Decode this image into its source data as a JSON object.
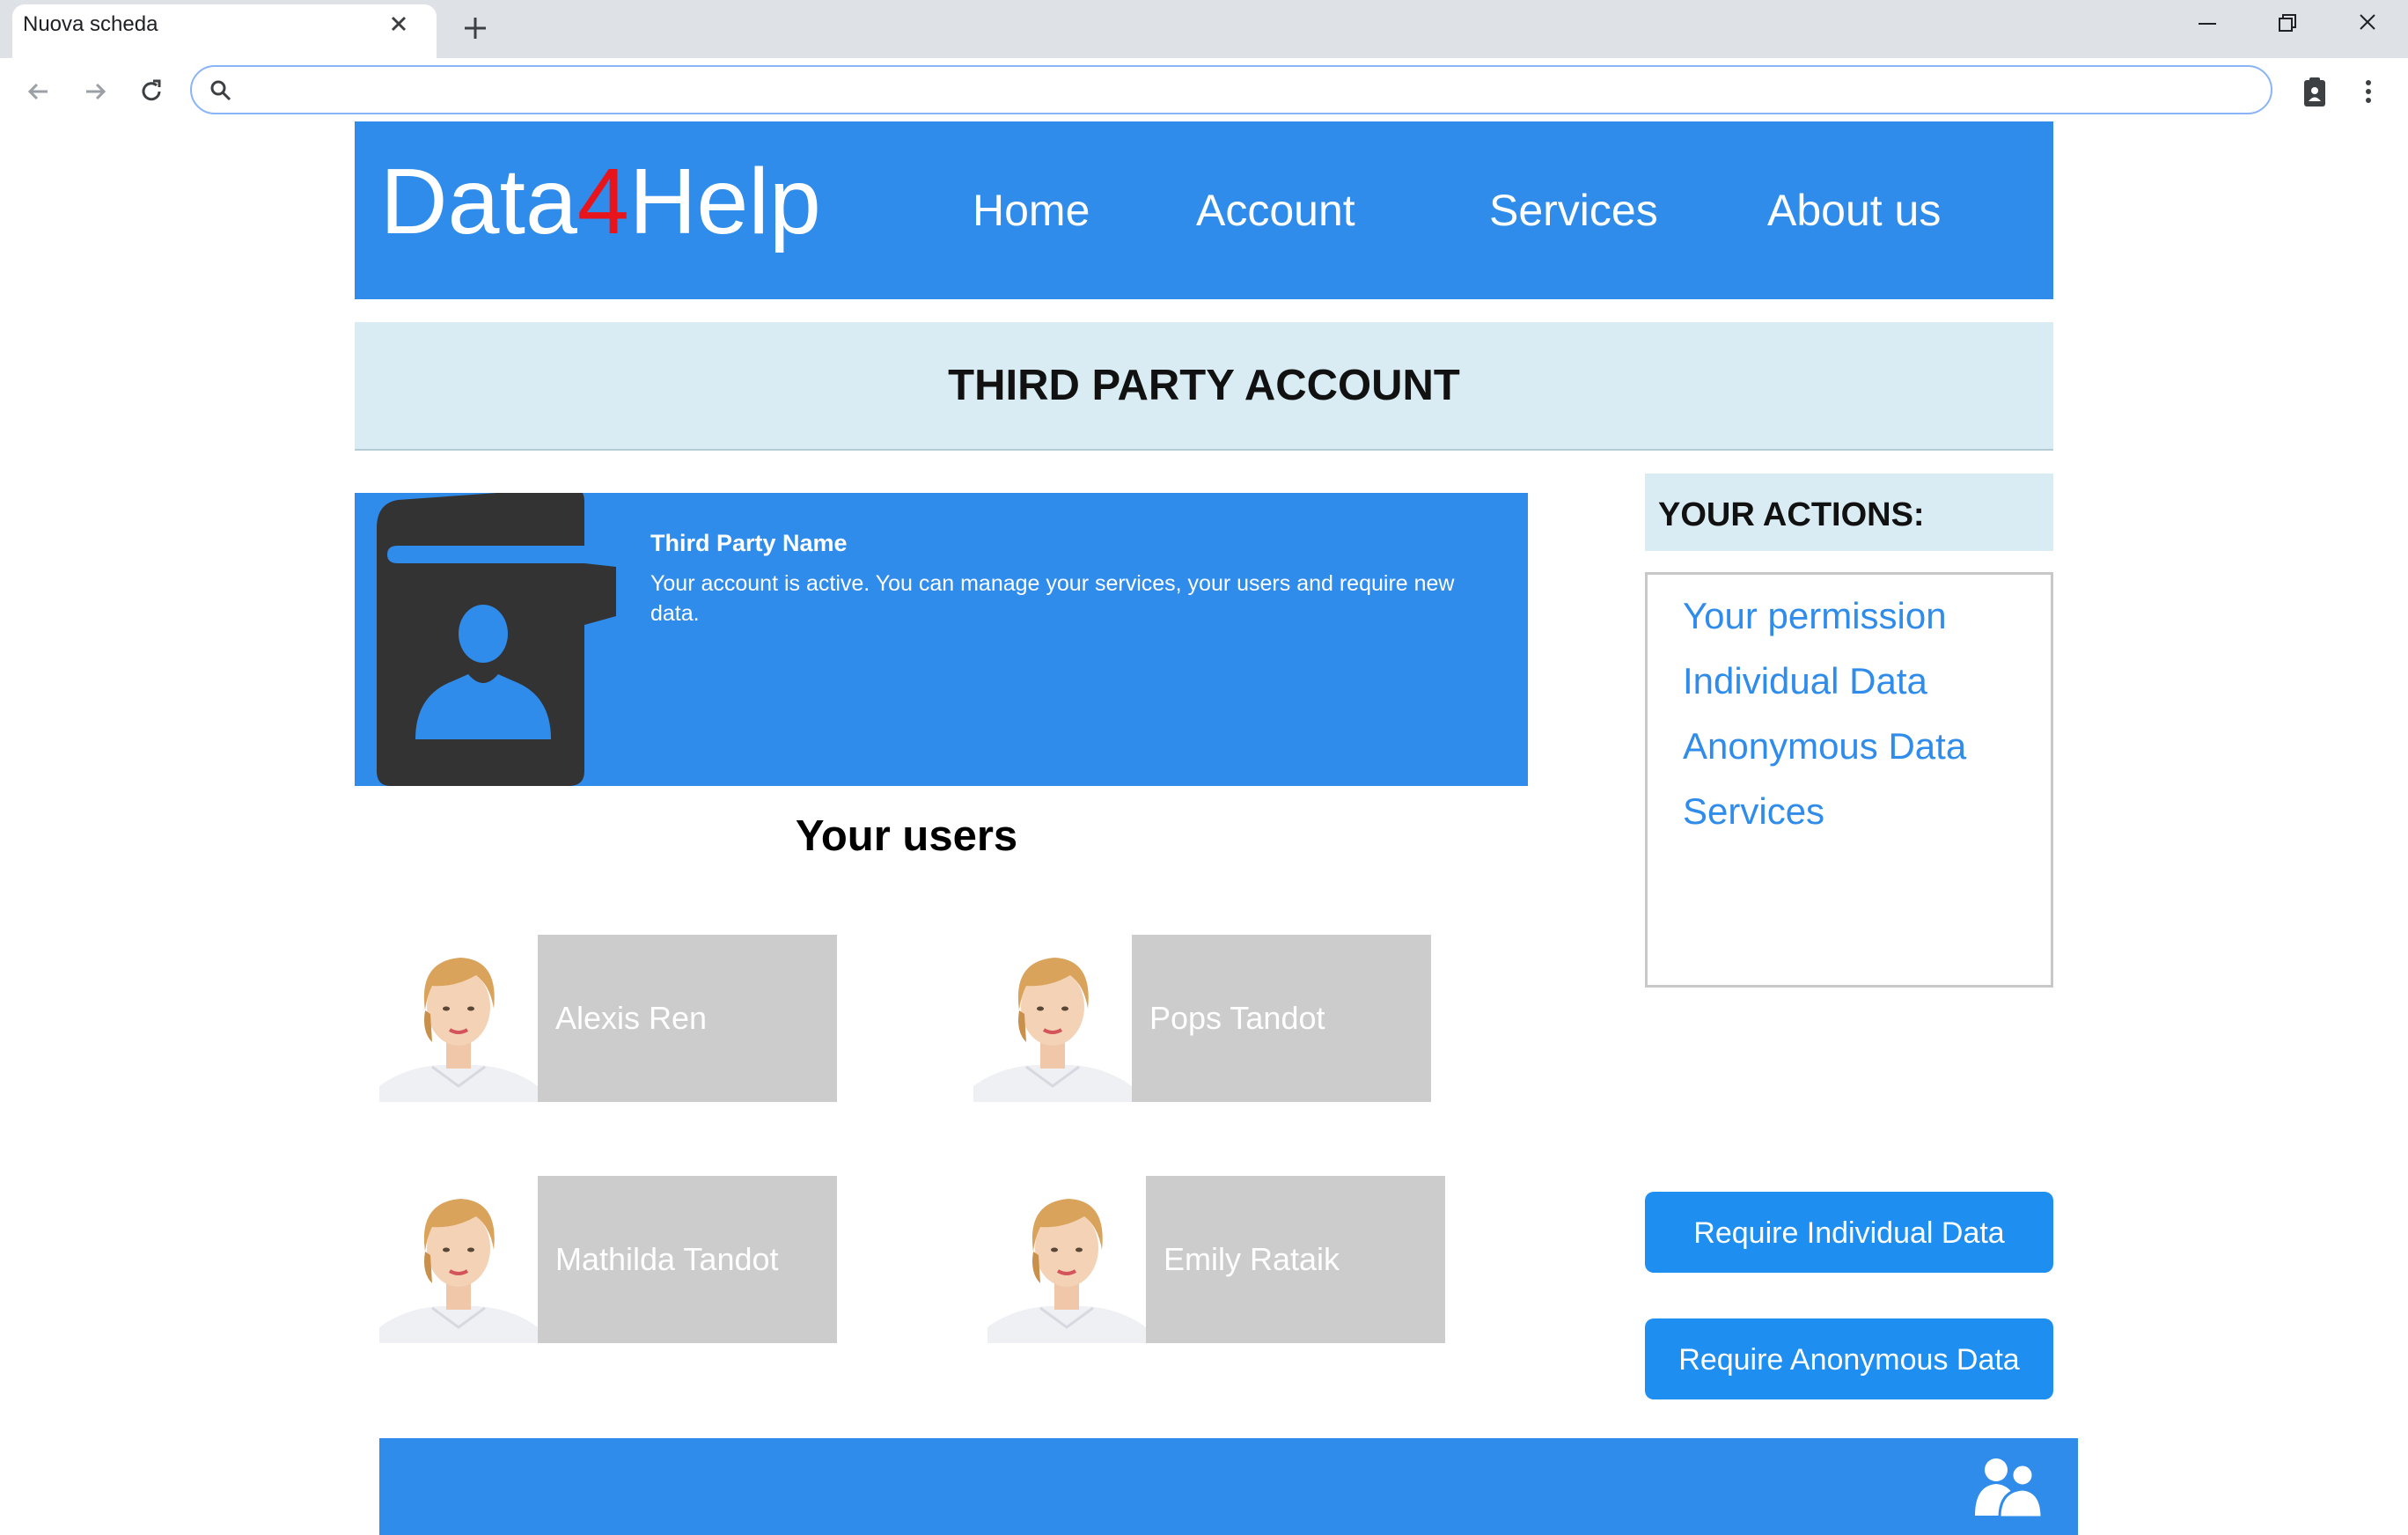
{
  "browser": {
    "tab_title": "Nuova scheda",
    "address_value": "",
    "icons": [
      "close-icon",
      "plus-icon",
      "minimize-icon",
      "restore-icon",
      "close-window-icon",
      "back-arrow-icon",
      "forward-arrow-icon",
      "reload-icon",
      "search-icon",
      "clipboard-profile-icon",
      "kebab-menu-icon"
    ]
  },
  "site": {
    "logo_part1": "Data",
    "logo_part2": "4",
    "logo_part3": "Help",
    "nav": [
      "Home",
      "Account",
      "Services",
      "About us"
    ]
  },
  "page": {
    "title": "THIRD PARTY ACCOUNT",
    "profile": {
      "name": "Third Party Name",
      "status": "Your account is active. You can manage your services, your users and require new data."
    },
    "users_heading": "Your users",
    "users": [
      "Alexis Ren",
      "Pops Tandot",
      "Mathilda Tandot",
      "Emily Rataik"
    ]
  },
  "actions": {
    "title": "YOUR ACTIONS:",
    "links": [
      "Your permission",
      "Individual Data",
      "Anonymous Data",
      "Services"
    ],
    "buttons": [
      "Require Individual Data",
      "Require Anonymous Data"
    ]
  },
  "colors": {
    "brand_blue": "#2f8ceb",
    "logo_accent": "#e8141c",
    "light_band": "#d9ecf3",
    "user_tile": "#cccccc"
  }
}
